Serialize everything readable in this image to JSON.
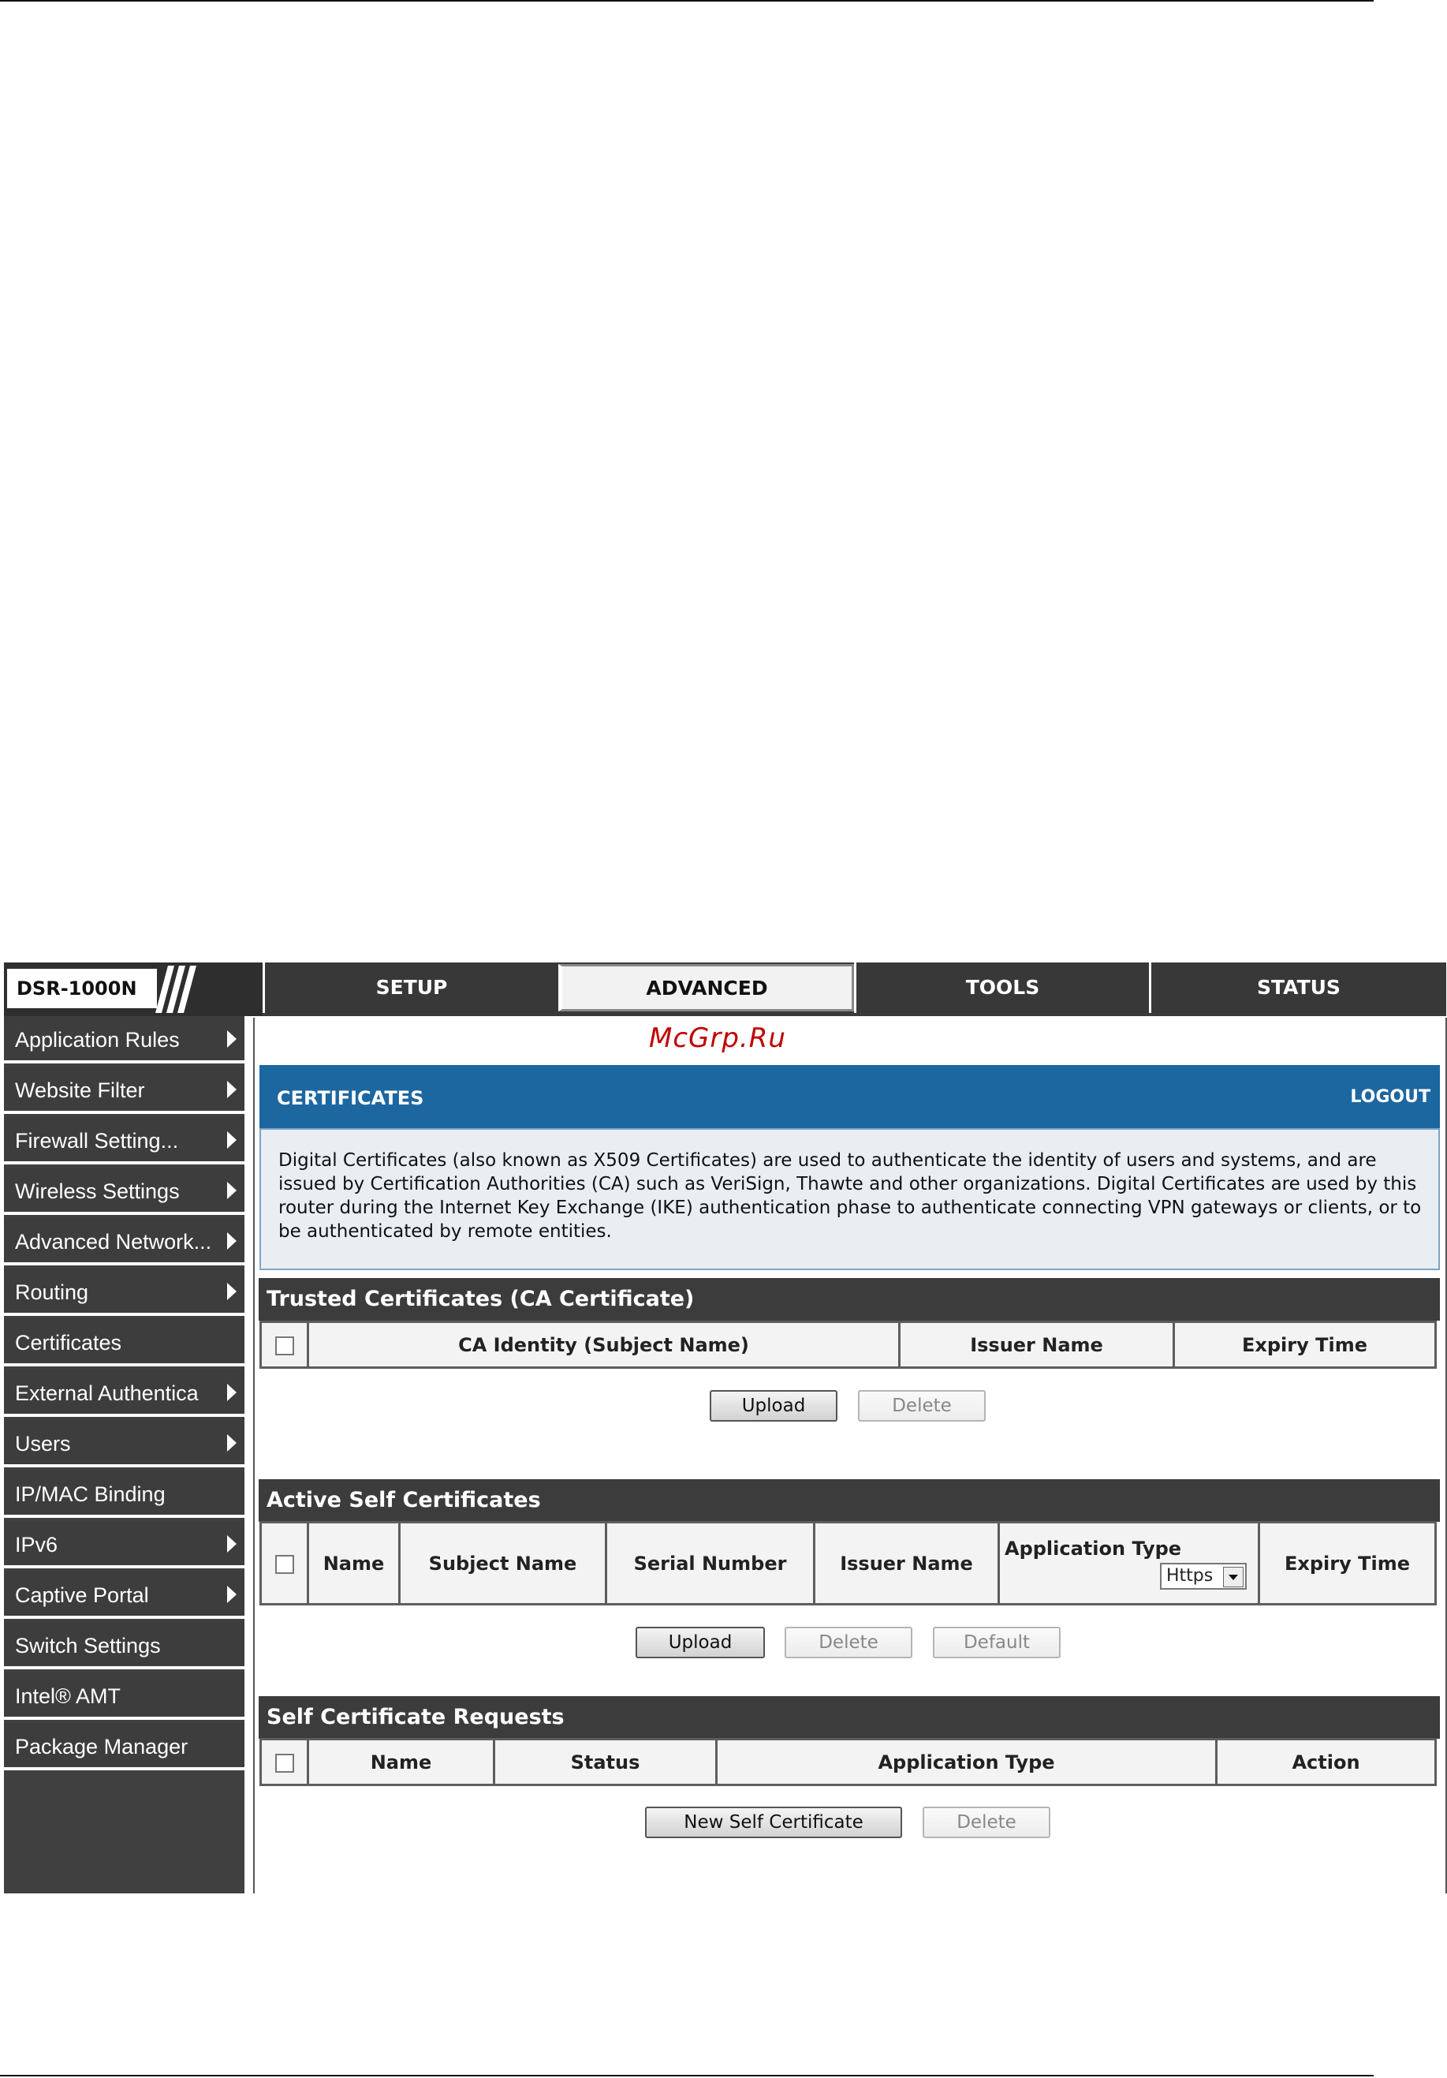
{
  "header": {
    "model": "DSR-1000N",
    "tabs": [
      {
        "label": "SETUP",
        "active": false
      },
      {
        "label": "ADVANCED",
        "active": true
      },
      {
        "label": "TOOLS",
        "active": false
      },
      {
        "label": "STATUS",
        "active": false
      }
    ]
  },
  "sidebar": {
    "items": [
      {
        "label": "Application Rules",
        "arrow": true
      },
      {
        "label": "Website Filter",
        "arrow": true
      },
      {
        "label": "Firewall Setting...",
        "arrow": true
      },
      {
        "label": "Wireless Settings",
        "arrow": true
      },
      {
        "label": "Advanced Network...",
        "arrow": true
      },
      {
        "label": "Routing",
        "arrow": true
      },
      {
        "label": "Certificates",
        "arrow": false
      },
      {
        "label": "External Authentica",
        "arrow": true
      },
      {
        "label": "Users",
        "arrow": true
      },
      {
        "label": "IP/MAC Binding",
        "arrow": false
      },
      {
        "label": "IPv6",
        "arrow": true
      },
      {
        "label": "Captive Portal",
        "arrow": true
      },
      {
        "label": "Switch Settings",
        "arrow": false
      },
      {
        "label": "Intel® AMT",
        "arrow": false
      },
      {
        "label": "Package Manager",
        "arrow": false
      }
    ]
  },
  "watermark": "McGrp.Ru",
  "page": {
    "title": "CERTIFICATES",
    "logout": "LOGOUT",
    "description": "Digital Certificates (also known as X509 Certificates) are used to authenticate the identity of users and systems, and are issued by Certification Authorities (CA) such as VeriSign, Thawte and other organizations. Digital Certificates are used by this router during the Internet Key Exchange (IKE) authentication phase to authenticate connecting VPN gateways or clients, or to be authenticated by remote entities."
  },
  "trusted": {
    "title": "Trusted Certificates (CA Certificate)",
    "columns": [
      "CA Identity (Subject Name)",
      "Issuer Name",
      "Expiry Time"
    ],
    "upload": "Upload",
    "delete": "Delete"
  },
  "active": {
    "title": "Active Self Certificates",
    "columns": [
      "Name",
      "Subject Name",
      "Serial Number",
      "Issuer Name",
      "Application Type",
      "Expiry Time"
    ],
    "app_type_selected": "Https",
    "upload": "Upload",
    "delete": "Delete",
    "default": "Default"
  },
  "requests": {
    "title": "Self Certificate Requests",
    "columns": [
      "Name",
      "Status",
      "Application Type",
      "Action"
    ],
    "new": "New Self Certificate",
    "delete": "Delete"
  }
}
